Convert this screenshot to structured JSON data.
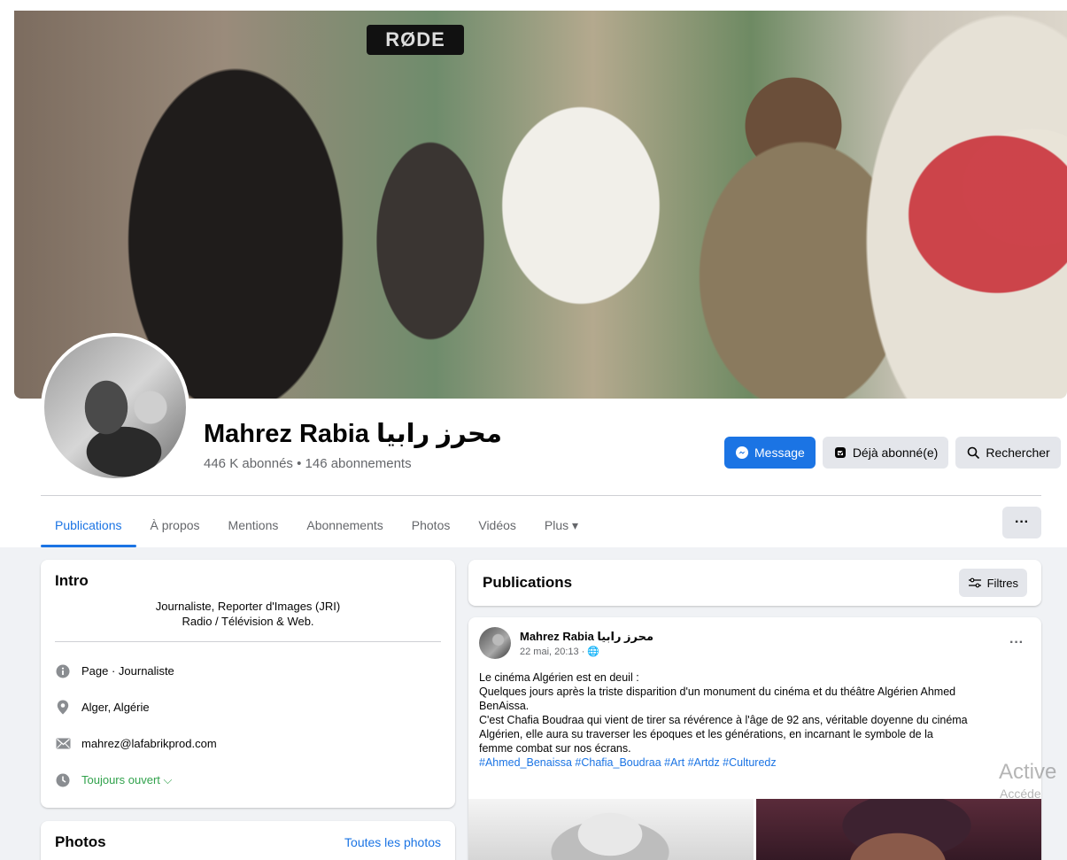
{
  "profile": {
    "name": "Mahrez Rabia محرز رابيا",
    "stats": "446 K abonnés • 146 abonnements",
    "cover_text": "RØDE"
  },
  "actions": {
    "message": "Message",
    "subscribed": "Déjà abonné(e)",
    "search": "Rechercher"
  },
  "tabs": [
    {
      "label": "Publications",
      "active": true
    },
    {
      "label": "À propos"
    },
    {
      "label": "Mentions"
    },
    {
      "label": "Abonnements"
    },
    {
      "label": "Photos"
    },
    {
      "label": "Vidéos"
    },
    {
      "label": "Plus ▾"
    }
  ],
  "more_label": "···",
  "intro": {
    "title": "Intro",
    "bio_line1": "Journaliste, Reporter d'Images (JRI)",
    "bio_line2": "Radio / Télévision & Web.",
    "details": [
      {
        "icon": "info-icon",
        "text": "Page · Journaliste"
      },
      {
        "icon": "location-pin-icon",
        "text": "Alger, Algérie"
      },
      {
        "icon": "email-icon",
        "text": "mahrez@lafabrikprod.com"
      },
      {
        "icon": "clock-icon",
        "text": "Toujours ouvert ⌵"
      }
    ]
  },
  "photos": {
    "title": "Photos",
    "link": "Toutes les photos"
  },
  "publications": {
    "title": "Publications",
    "filters": "Filtres"
  },
  "post": {
    "author": "Mahrez Rabia محرز رابيا",
    "time": "22 mai, 20:13 · 🌐",
    "menu": "···",
    "lines": [
      "Le cinéma Algérien est en deuil :",
      "Quelques jours après la triste disparition d'un monument du cinéma et du théâtre Algérien Ahmed",
      "BenAissa.",
      "C'est Chafia Boudraa qui vient de tirer sa révérence à l'âge de 92 ans, véritable doyenne du cinéma",
      "Algérien, elle aura su traverser les époques et les générations, en incarnant le symbole de la",
      "femme combat sur nos écrans."
    ],
    "tags": "#Ahmed_Benaissa #Chafia_Boudraa #Art #Artdz #Culturedz"
  },
  "watermark": {
    "line1": "Active",
    "line2": "Accéde"
  },
  "colors": {
    "accent": "#1b74e4",
    "open_status": "#31a24c",
    "background": "#f0f2f5"
  }
}
